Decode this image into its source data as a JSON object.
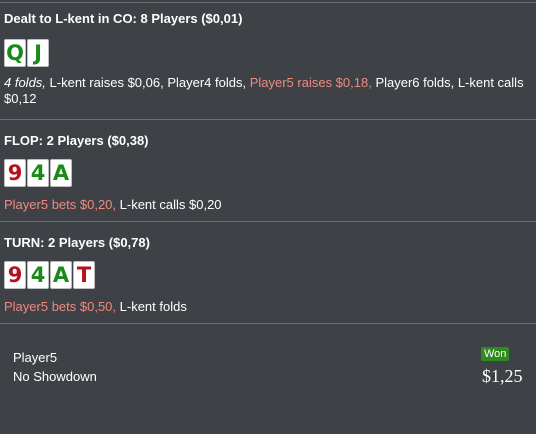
{
  "preflop": {
    "title": "Dealt to L-kent in CO: 8 Players ($0,01)",
    "cards": [
      {
        "rank": "Q",
        "color": "green"
      },
      {
        "rank": "J",
        "color": "green"
      }
    ],
    "actions": [
      {
        "text": "4 folds,",
        "style": "it"
      },
      {
        "text": " L-kent raises $0,06, Player4 folds, ",
        "style": ""
      },
      {
        "text": "Player5 raises $0,18,",
        "style": "hl"
      },
      {
        "text": " Player6 folds, L-kent calls $0,12",
        "style": ""
      }
    ]
  },
  "flop": {
    "title": "FLOP: 2 Players ($0,38)",
    "cards": [
      {
        "rank": "9",
        "color": "red"
      },
      {
        "rank": "4",
        "color": "green"
      },
      {
        "rank": "A",
        "color": "green"
      }
    ],
    "actions": [
      {
        "text": "Player5 bets $0,20,",
        "style": "hl"
      },
      {
        "text": " L-kent calls $0,20",
        "style": ""
      }
    ]
  },
  "turn": {
    "title": "TURN: 2 Players ($0,78)",
    "cards": [
      {
        "rank": "9",
        "color": "red"
      },
      {
        "rank": "4",
        "color": "green"
      },
      {
        "rank": "A",
        "color": "green"
      },
      {
        "rank": "T",
        "color": "red"
      }
    ],
    "actions": [
      {
        "text": "Player5 bets $0,50,",
        "style": "hl"
      },
      {
        "text": " L-kent folds",
        "style": ""
      }
    ]
  },
  "summary": {
    "player": "Player5",
    "result": "No Showdown",
    "badge": "Won",
    "amount": "$1,25"
  },
  "colors": {
    "background": "#3e4145",
    "highlight": "#f08a80",
    "card_green": "#1a8a1a",
    "card_red": "#b5121b",
    "won_badge": "#2f8a1e"
  }
}
